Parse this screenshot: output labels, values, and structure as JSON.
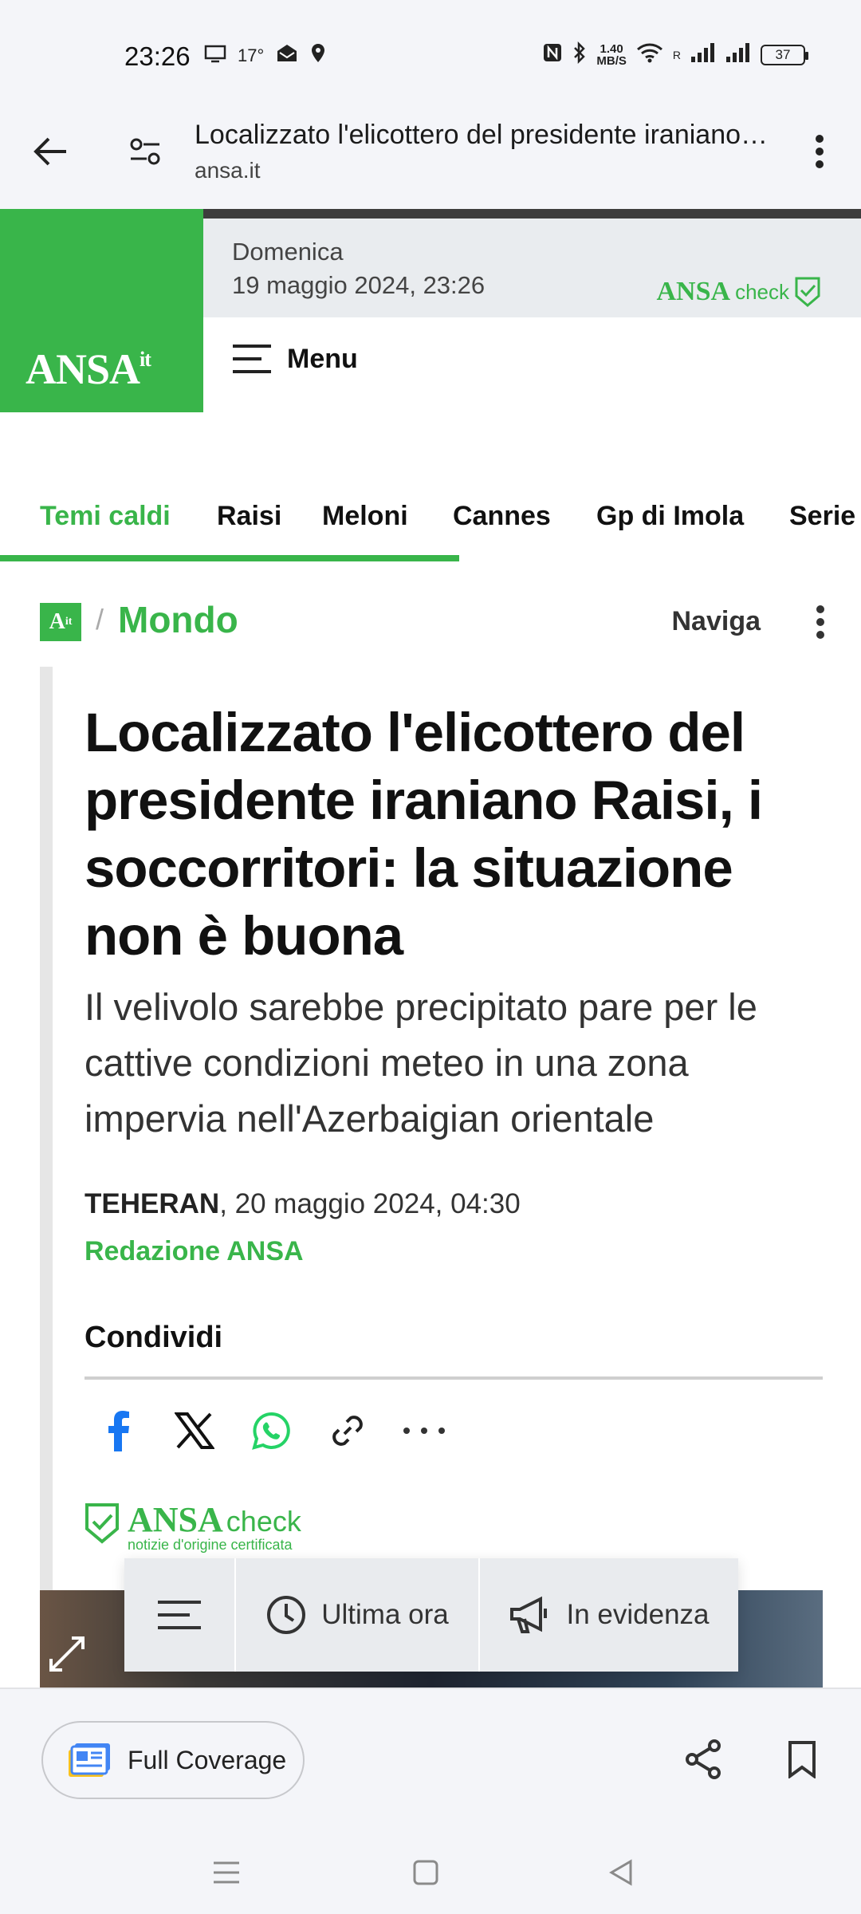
{
  "status_bar": {
    "time": "23:26",
    "temperature": "17°",
    "net_speed_value": "1.40",
    "net_speed_unit": "MB/S",
    "roaming": "R",
    "battery": "37"
  },
  "browser": {
    "page_title": "Localizzato l'elicottero del presidente iraniano Raisi, i soccorritori: la situazione non è buona",
    "url": "ansa.it"
  },
  "site_header": {
    "logo_main": "ANSA",
    "logo_suffix": "it",
    "day": "Domenica",
    "date": "19 maggio 2024, 23:26",
    "ansacheck_ansa": "ANSA",
    "ansacheck_check": "check",
    "menu_label": "Menu"
  },
  "topics": {
    "items": [
      "Temi caldi",
      "Raisi",
      "Meloni",
      "Cannes",
      "Gp di Imola",
      "Serie"
    ]
  },
  "section": {
    "logo": "A",
    "logo_suffix": "it",
    "slash": "/",
    "name": "Mondo",
    "naviga": "Naviga"
  },
  "article": {
    "headline": "Localizzato l'elicottero del presidente iraniano Raisi, i soccorritori: la situazione non è buona",
    "subhead": "Il velivolo sarebbe precipitato pare per le cattive condizioni meteo in una zona impervia nell'Azerbaigian orientale",
    "place": "TEHERAN",
    "datetime": ", 20 maggio 2024, 04:30",
    "author": "Redazione ANSA",
    "share_title": "Condividi",
    "ansacheck_ansa": "ANSA",
    "ansacheck_check": "check",
    "ansacheck_sub": "notizie d'origine certificata"
  },
  "floating_menu": {
    "ultima_ora": "Ultima ora",
    "in_evidenza": "In evidenza"
  },
  "bottom_bar": {
    "full_coverage": "Full Coverage"
  },
  "colors": {
    "brand_green": "#39b54a",
    "header_gray": "#e9ecef",
    "browser_bg": "#f4f5f9"
  }
}
